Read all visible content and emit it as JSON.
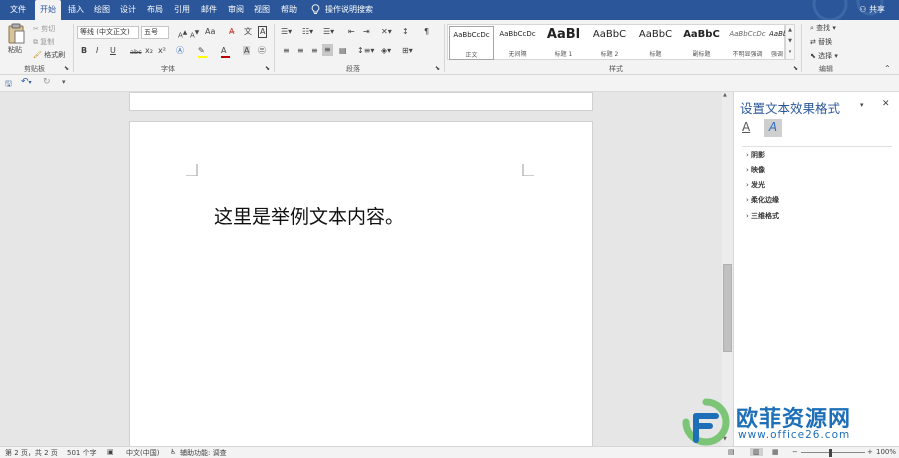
{
  "tabs": [
    {
      "label": "文件"
    },
    {
      "label": "开始"
    },
    {
      "label": "插入"
    },
    {
      "label": "绘图"
    },
    {
      "label": "设计"
    },
    {
      "label": "布局"
    },
    {
      "label": "引用"
    },
    {
      "label": "邮件"
    },
    {
      "label": "审阅"
    },
    {
      "label": "视图"
    },
    {
      "label": "帮助"
    }
  ],
  "search_label": "操作说明搜索",
  "share_label": "共享",
  "clipboard": {
    "paste": "粘贴",
    "cut": "剪切",
    "copy": "复制",
    "format_painter": "格式刷",
    "group": "剪贴板"
  },
  "font": {
    "name": "等线 (中文正文)",
    "size": "五号",
    "group": "字体",
    "bold": "B",
    "italic": "I",
    "underline": "U",
    "strike": "abc",
    "sub": "x₂",
    "sup": "x²",
    "case": "Aa",
    "clear": "A"
  },
  "paragraph": {
    "group": "段落"
  },
  "styles": {
    "group": "样式",
    "items": [
      {
        "sample": "AaBbCcDc",
        "name": "正文"
      },
      {
        "sample": "AaBbCcDc",
        "name": "无间隔"
      },
      {
        "sample": "AaBl",
        "name": "标题 1"
      },
      {
        "sample": "AaBbC",
        "name": "标题 2"
      },
      {
        "sample": "AaBbC",
        "name": "标题"
      },
      {
        "sample": "AaBbC",
        "name": "副标题"
      },
      {
        "sample": "AaBbCcDc",
        "name": "不明显强调"
      },
      {
        "sample": "AaBbCcDc",
        "name": "强调"
      }
    ]
  },
  "editing": {
    "find": "查找",
    "replace": "替换",
    "select": "选择",
    "group": "编辑"
  },
  "document": {
    "text": "这里是举例文本内容。"
  },
  "pane": {
    "title": "设置文本效果格式",
    "sections": [
      {
        "label": "阴影"
      },
      {
        "label": "映像"
      },
      {
        "label": "发光"
      },
      {
        "label": "柔化边缘"
      },
      {
        "label": "三维格式"
      }
    ]
  },
  "status": {
    "page": "第 2 页，共 2 页",
    "words": "501 个字",
    "lang": "中文(中国)",
    "accessibility": "辅助功能: 调查",
    "zoom": "100%"
  },
  "watermark": {
    "brand": "欧菲资源网",
    "url": "www.office26.com"
  },
  "colors": {
    "accent": "#2b579a",
    "highlight": "#ffff00",
    "font_color": "#c00000"
  }
}
